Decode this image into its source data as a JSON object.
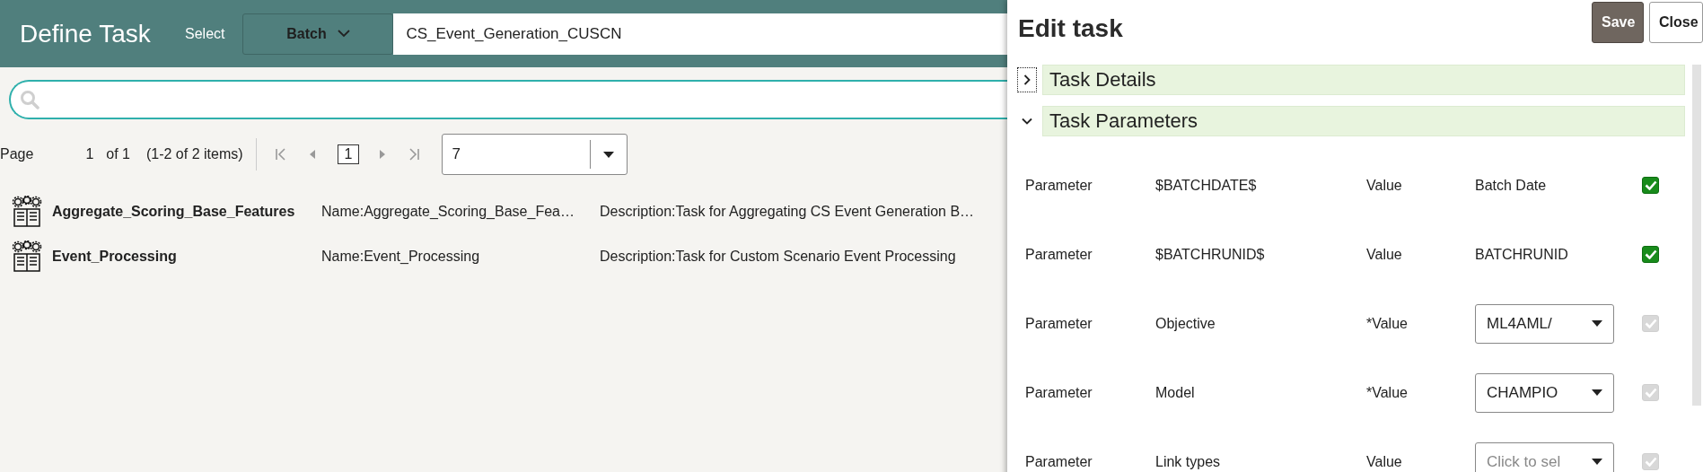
{
  "header": {
    "title": "Define Task",
    "select_label": "Select",
    "batch_button": "Batch",
    "batch_value": "CS_Event_Generation_CUSCN"
  },
  "pagination": {
    "page_label": "Page",
    "page": "1",
    "of": "of 1",
    "range": "(1-2 of 2 items)",
    "current_page": "1",
    "page_size": "7"
  },
  "tasks": [
    {
      "name": "Aggregate_Scoring_Base_Features",
      "detail_name": "Name:Aggregate_Scoring_Base_Fea…",
      "description": "Description:Task for Aggregating CS Event Generation B…"
    },
    {
      "name": "Event_Processing",
      "detail_name": "Name:Event_Processing",
      "description": "Description:Task for Custom Scenario Event Processing"
    }
  ],
  "edit_panel": {
    "title": "Edit task",
    "buttons": [
      {
        "label": "Save",
        "kind": "primary"
      },
      {
        "label": "Close",
        "kind": "secondary"
      }
    ],
    "sections": [
      {
        "title": "Task Details",
        "expanded": false
      },
      {
        "title": "Task Parameters",
        "expanded": true
      }
    ],
    "parameters": [
      {
        "label": "Parameter",
        "name": "$BATCHDATE$",
        "value_label": "Value",
        "kind": "text",
        "value": "Batch Date",
        "checked": true,
        "disabled": false
      },
      {
        "label": "Parameter",
        "name": "$BATCHRUNID$",
        "value_label": "Value",
        "kind": "text",
        "value": "BATCHRUNID",
        "checked": true,
        "disabled": false
      },
      {
        "label": "Parameter",
        "name": "Objective",
        "value_label": "*Value",
        "kind": "select",
        "value": "ML4AML/",
        "checked": true,
        "disabled": true
      },
      {
        "label": "Parameter",
        "name": "Model",
        "value_label": "*Value",
        "kind": "select",
        "value": "CHAMPIO",
        "checked": true,
        "disabled": true
      },
      {
        "label": "Parameter",
        "name": "Link types",
        "value_label": "Value",
        "kind": "select",
        "placeholder": "Click to sel",
        "checked": true,
        "disabled": true
      }
    ]
  }
}
